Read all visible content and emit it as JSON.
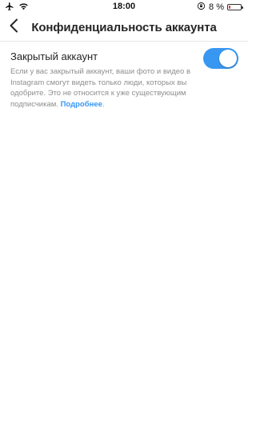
{
  "status_bar": {
    "time": "18:00",
    "battery_percent_label": "8 %",
    "battery_level": 0.08,
    "left_icons": [
      "airplane-icon",
      "wifi-icon"
    ],
    "right_icons": [
      "orientation-lock-icon",
      "battery-icon"
    ]
  },
  "header": {
    "title": "Конфиденциальность аккаунта",
    "back_icon": "chevron-left-icon"
  },
  "private_account": {
    "title": "Закрытый аккаунт",
    "description": "Если у вас закрытый аккаунт, ваши фото и видео в Instagram смогут видеть только люди, которых вы одобрите. Это не относится к уже существующим подписчикам.",
    "learn_more": "Подробнее",
    "enabled": true
  },
  "colors": {
    "accent": "#3897f0",
    "text_primary": "#262626",
    "text_secondary": "#8e8e8e",
    "battery_low": "#e53935"
  }
}
